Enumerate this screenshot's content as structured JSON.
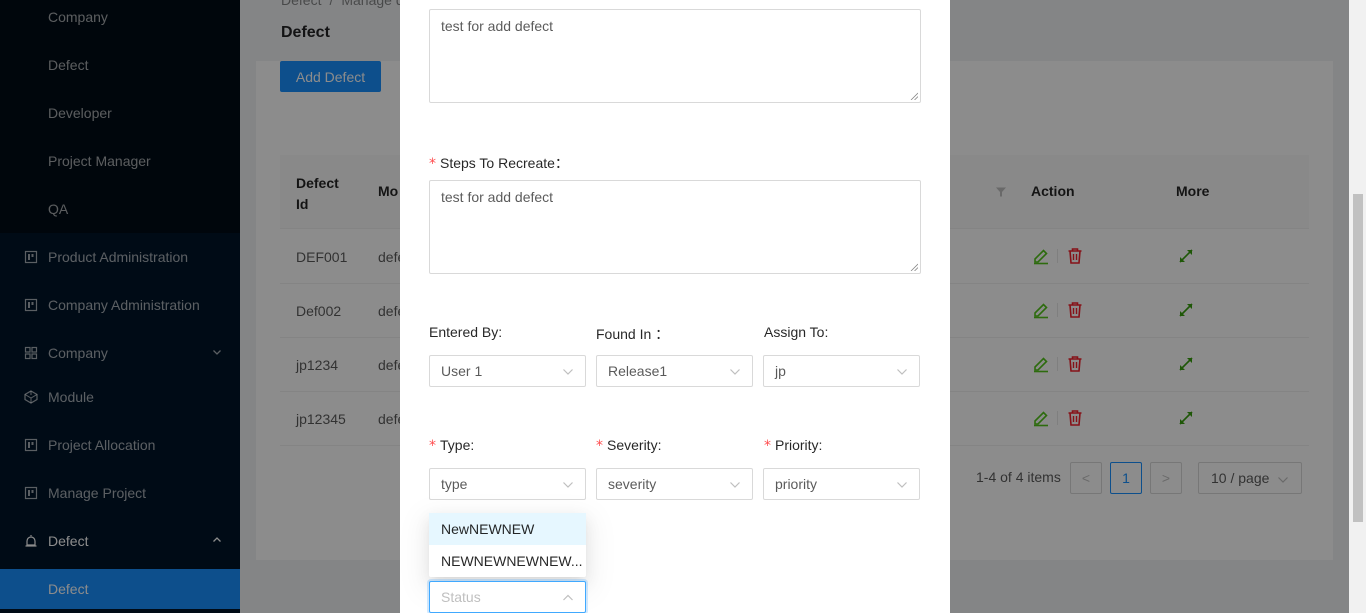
{
  "sidebar": {
    "sub_items": [
      {
        "label": "Company"
      },
      {
        "label": "Defect"
      },
      {
        "label": "Developer"
      },
      {
        "label": "Project Manager"
      },
      {
        "label": "QA"
      }
    ],
    "menu": [
      {
        "label": "Product Administration",
        "icon": "project-icon"
      },
      {
        "label": "Company Administration",
        "icon": "project-icon"
      },
      {
        "label": "Company",
        "icon": "appstore-icon"
      },
      {
        "label": "Module",
        "icon": "codepen-icon"
      },
      {
        "label": "Project Allocation",
        "icon": "project-icon"
      },
      {
        "label": "Manage Project",
        "icon": "project-icon"
      },
      {
        "label": "Defect",
        "icon": "alert-icon"
      }
    ],
    "selected": {
      "label": "Defect"
    },
    "selected_color": "#1890ff"
  },
  "breadcrumb": {
    "first": "Defect",
    "separator": "/",
    "second": "Manage d"
  },
  "page": {
    "title": "Defect",
    "add_button": "Add Defect"
  },
  "table": {
    "headers": {
      "defect_id": "Defect Id",
      "module": "Mo",
      "action": "Action",
      "more": "More"
    },
    "rows": [
      {
        "id": "DEF001",
        "module": "defe"
      },
      {
        "id": "Def002",
        "module": "defe"
      },
      {
        "id": "jp1234",
        "module": "defe"
      },
      {
        "id": "jp12345",
        "module": "defe"
      }
    ]
  },
  "pagination": {
    "total": "1-4 of 4 items",
    "prev": "<",
    "current": "1",
    "next": ">",
    "page_size": "10 / page"
  },
  "modal": {
    "description_value": "test for add defect",
    "steps_label": "Steps To Recreate",
    "steps_colon": "：",
    "steps_value": "test for add defect",
    "entered_by": {
      "label": "Entered By:",
      "value": "User 1"
    },
    "found_in": {
      "label": "Found In ：",
      "value": "Release1"
    },
    "assign_to": {
      "label": "Assign To:",
      "value": "jp"
    },
    "type": {
      "label": "Type:",
      "value": "type"
    },
    "severity": {
      "label": "Severity:",
      "value": "severity"
    },
    "priority": {
      "label": "Priority:",
      "value": "priority"
    },
    "status": {
      "placeholder": "Status"
    },
    "required_mark": "*"
  },
  "status_dropdown": {
    "options": [
      "NewNEWNEW",
      "NEWNEWNEWNEW..."
    ],
    "active_index": 0
  },
  "colors": {
    "primary": "#1890ff",
    "danger": "#f5222d",
    "success": "#52c41a",
    "sidebar_bg": "#001529"
  }
}
